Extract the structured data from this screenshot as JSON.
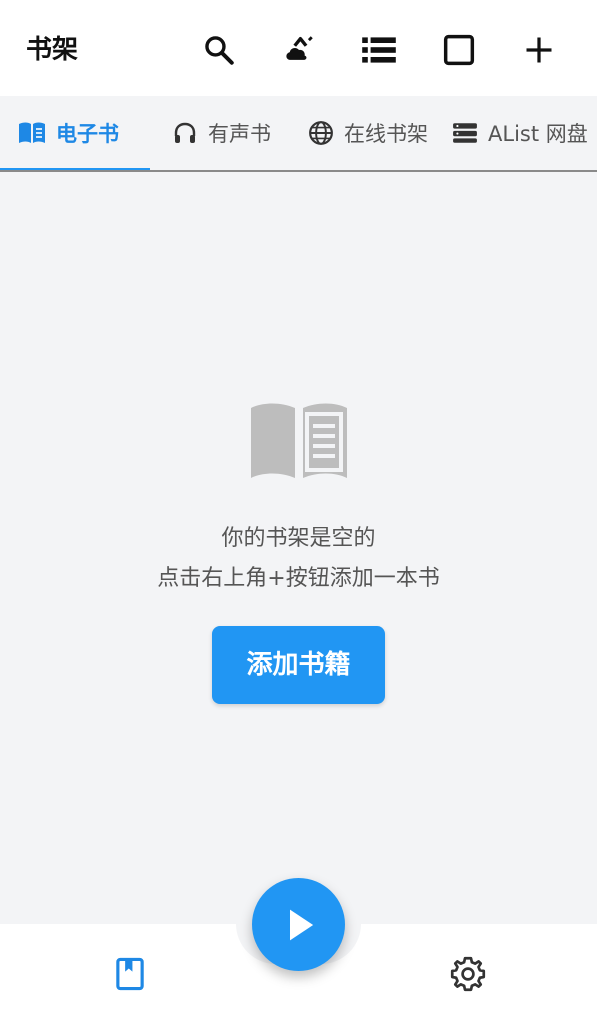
{
  "appbar": {
    "title": "书架",
    "actions": [
      {
        "icon": "search-icon"
      },
      {
        "icon": "cloud-sync-icon"
      },
      {
        "icon": "list-view-icon"
      },
      {
        "icon": "select-square-icon"
      },
      {
        "icon": "add-icon"
      }
    ]
  },
  "tabs": [
    {
      "label": "电子书",
      "icon": "book-open-icon",
      "active": true
    },
    {
      "label": "有声书",
      "icon": "headphones-icon",
      "active": false
    },
    {
      "label": "在线书架",
      "icon": "globe-icon",
      "active": false
    },
    {
      "label": "AList 网盘",
      "icon": "server-icon",
      "active": false
    }
  ],
  "empty_state": {
    "icon": "open-book-icon",
    "title": "你的书架是空的",
    "hint": "点击右上角+按钮添加一本书",
    "button_label": "添加书籍"
  },
  "bottom_nav": {
    "items": [
      {
        "icon": "bookshelf-icon",
        "active": true
      },
      {
        "icon": "settings-icon",
        "active": false
      }
    ],
    "fab_icon": "play-icon"
  },
  "colors": {
    "accent": "#2196f3",
    "background": "#f3f4f6",
    "text_muted": "#555555"
  }
}
